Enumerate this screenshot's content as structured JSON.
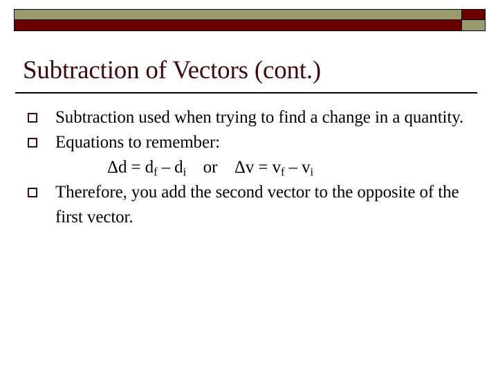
{
  "slide": {
    "title": "Subtraction of Vectors (cont.)",
    "background_color": "#ffffff",
    "title_color": "#3d0b0b",
    "accent_olive": "#9a9a6e",
    "accent_maroon": "#6b0000",
    "body_color": "#000000"
  },
  "header_decoration": {
    "olive_bar_name": "olive-bar",
    "maroon_bar_name": "maroon-bar",
    "corner_maroon_name": "corner-maroon-square",
    "corner_olive_name": "corner-olive-square"
  },
  "bullets": [
    {
      "marker": "hollow-square",
      "text": "Subtraction used when trying to find a change in a quantity."
    },
    {
      "marker": "hollow-square",
      "text": "Equations to remember:"
    },
    {
      "marker": "hollow-square",
      "text": "Therefore, you add the second vector to the opposite of the first vector."
    }
  ],
  "equation": {
    "left_delta": "Δd = d",
    "left_sub_f": "f",
    "left_minus": " – d",
    "left_sub_i": "i",
    "connector": "    or    ",
    "right_delta": "Δv = v",
    "right_sub_f": "f",
    "right_minus": " – v",
    "right_sub_i": "i",
    "full_text": "Δd = df – di    or    Δv = vf – vi"
  }
}
